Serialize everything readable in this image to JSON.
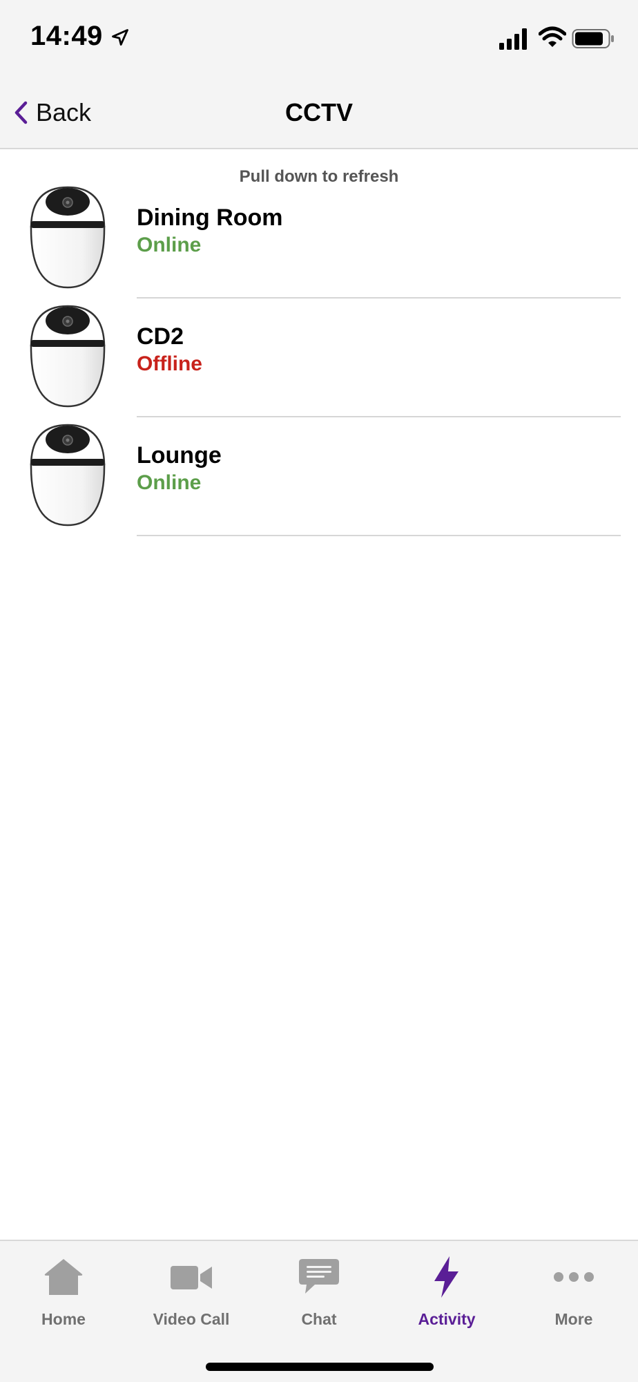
{
  "status_bar": {
    "time": "14:49",
    "location_icon": "location-arrow-icon",
    "signal_icon": "cellular-signal-icon",
    "wifi_icon": "wifi-icon",
    "battery_icon": "battery-icon"
  },
  "nav": {
    "back_label": "Back",
    "title": "CCTV"
  },
  "refresh_hint": "Pull down to refresh",
  "cameras": [
    {
      "name": "Dining Room",
      "status": "Online",
      "status_color": "#5c9e4a",
      "icon": "camera-icon"
    },
    {
      "name": "CD2",
      "status": "Offline",
      "status_color": "#c8221b",
      "icon": "camera-icon"
    },
    {
      "name": "Lounge",
      "status": "Online",
      "status_color": "#5c9e4a",
      "icon": "camera-icon"
    }
  ],
  "tabs": [
    {
      "label": "Home",
      "icon": "home-icon",
      "active": false
    },
    {
      "label": "Video Call",
      "icon": "video-camera-icon",
      "active": false
    },
    {
      "label": "Chat",
      "icon": "chat-bubble-icon",
      "active": false
    },
    {
      "label": "Activity",
      "icon": "lightning-bolt-icon",
      "active": true
    },
    {
      "label": "More",
      "icon": "more-dots-icon",
      "active": false
    }
  ],
  "colors": {
    "accent": "#5a1e96",
    "inactive_tab": "#707070",
    "bar_background": "#f4f4f4"
  }
}
